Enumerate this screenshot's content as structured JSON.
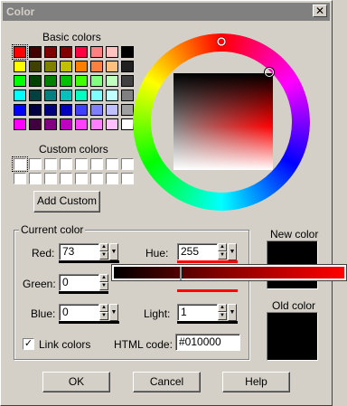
{
  "window": {
    "title": "Color",
    "close_glyph": "✕"
  },
  "basic_colors": {
    "label": "Basic colors",
    "swatches": [
      "#ff0000",
      "#400000",
      "#800000",
      "#800000",
      "#ff0040",
      "#ff8080",
      "#ffc0c0",
      "#000000",
      "#ffff00",
      "#404000",
      "#808000",
      "#c0c000",
      "#ff8000",
      "#ff8040",
      "#ffc080",
      "#202020",
      "#00ff00",
      "#004000",
      "#008000",
      "#00c000",
      "#40ff00",
      "#80ff80",
      "#c0ffc0",
      "#404040",
      "#00ffff",
      "#004040",
      "#008080",
      "#00c0c0",
      "#00ffc0",
      "#80ffff",
      "#c0ffff",
      "#808080",
      "#0000ff",
      "#000040",
      "#000080",
      "#0000c0",
      "#4040ff",
      "#8080ff",
      "#c0c0ff",
      "#a0a0a0",
      "#ff00ff",
      "#400040",
      "#800080",
      "#c000c0",
      "#ff40ff",
      "#ff80ff",
      "#ffc0ff",
      "#ffffff"
    ]
  },
  "custom_colors": {
    "label": "Custom colors",
    "add_button": "Add Custom"
  },
  "current_color": {
    "label": "Current color",
    "red": {
      "label": "Red:",
      "value": "73"
    },
    "green": {
      "label": "Green:",
      "value": "0"
    },
    "blue": {
      "label": "Blue:",
      "value": "0"
    },
    "hue": {
      "label": "Hue:",
      "value": "255"
    },
    "light": {
      "label": "Light:",
      "value": "1"
    },
    "link_colors": {
      "label": "Link colors",
      "checked": true,
      "check_glyph": "✓"
    },
    "html_code": {
      "label": "HTML code:",
      "value": "#010000"
    },
    "spin_up": "▲",
    "spin_down": "▼",
    "dropdown": "▼"
  },
  "preview": {
    "new_label": "New color",
    "new_color": "#000000",
    "old_label": "Old color",
    "old_color": "#000000"
  },
  "buttons": {
    "ok": "OK",
    "cancel": "Cancel",
    "help": "Help"
  }
}
